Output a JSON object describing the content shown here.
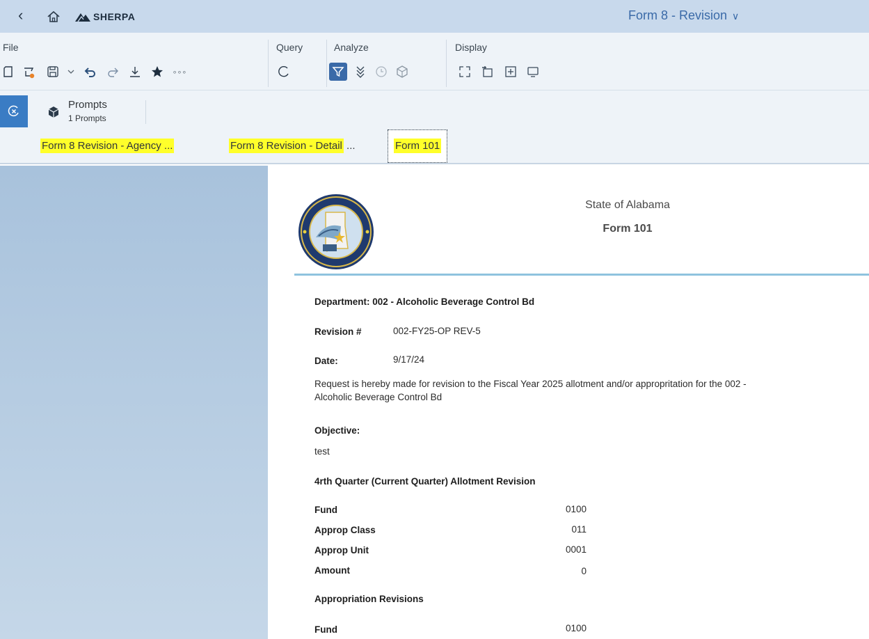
{
  "shell": {
    "back_icon": "back-chevron-icon",
    "home_icon": "home-icon",
    "brand": "SHERPA",
    "doc_title": "Form 8 - Revision",
    "doc_title_chevron": "∨"
  },
  "toolbar": {
    "sections": {
      "file": "File",
      "query": "Query",
      "analyze": "Analyze",
      "display": "Display"
    },
    "more_label": "∘∘∘"
  },
  "prompts": {
    "label": "Prompts",
    "count": "1 Prompts"
  },
  "tabs": [
    {
      "label": "Form 8 Revision - Agency ...",
      "highlighted": true,
      "selected": false
    },
    {
      "label": "Form 8 Revision - Detail",
      "suffix": " ...",
      "highlighted": true,
      "selected": false
    },
    {
      "label": "Form 101",
      "highlighted": true,
      "selected": true
    }
  ],
  "report": {
    "state": "State of Alabama",
    "form": "Form 101",
    "department": "Department: 002 - Alcoholic Beverage Control Bd",
    "revision_label": "Revision #",
    "revision_value": "002-FY25-OP REV-5",
    "date_label": "Date:",
    "date_value": "9/17/24",
    "request_line1": "Request is hereby made for revision to the Fiscal Year 2025 allotment and/or appropritation for the 002 -",
    "request_line2": "Alcoholic Beverage Control Bd",
    "objective_label": "Objective:",
    "objective_value": "test",
    "allotment_heading": "4rth Quarter (Current Quarter) Allotment Revision",
    "allotment": [
      {
        "label": "Fund",
        "value": "0100"
      },
      {
        "label": "Approp Class",
        "value": "011"
      },
      {
        "label": "Approp Unit",
        "value": "0001"
      },
      {
        "label": "Amount",
        "value": "0"
      }
    ],
    "appropriation_heading": "Appropriation Revisions",
    "appropriation": [
      {
        "label": "Fund",
        "value": "0100"
      }
    ]
  },
  "colors": {
    "shell_bg": "#c8d9ec",
    "accent": "#3a6aa8",
    "highlight": "#ffff2a",
    "rule": "#8fc3de"
  }
}
